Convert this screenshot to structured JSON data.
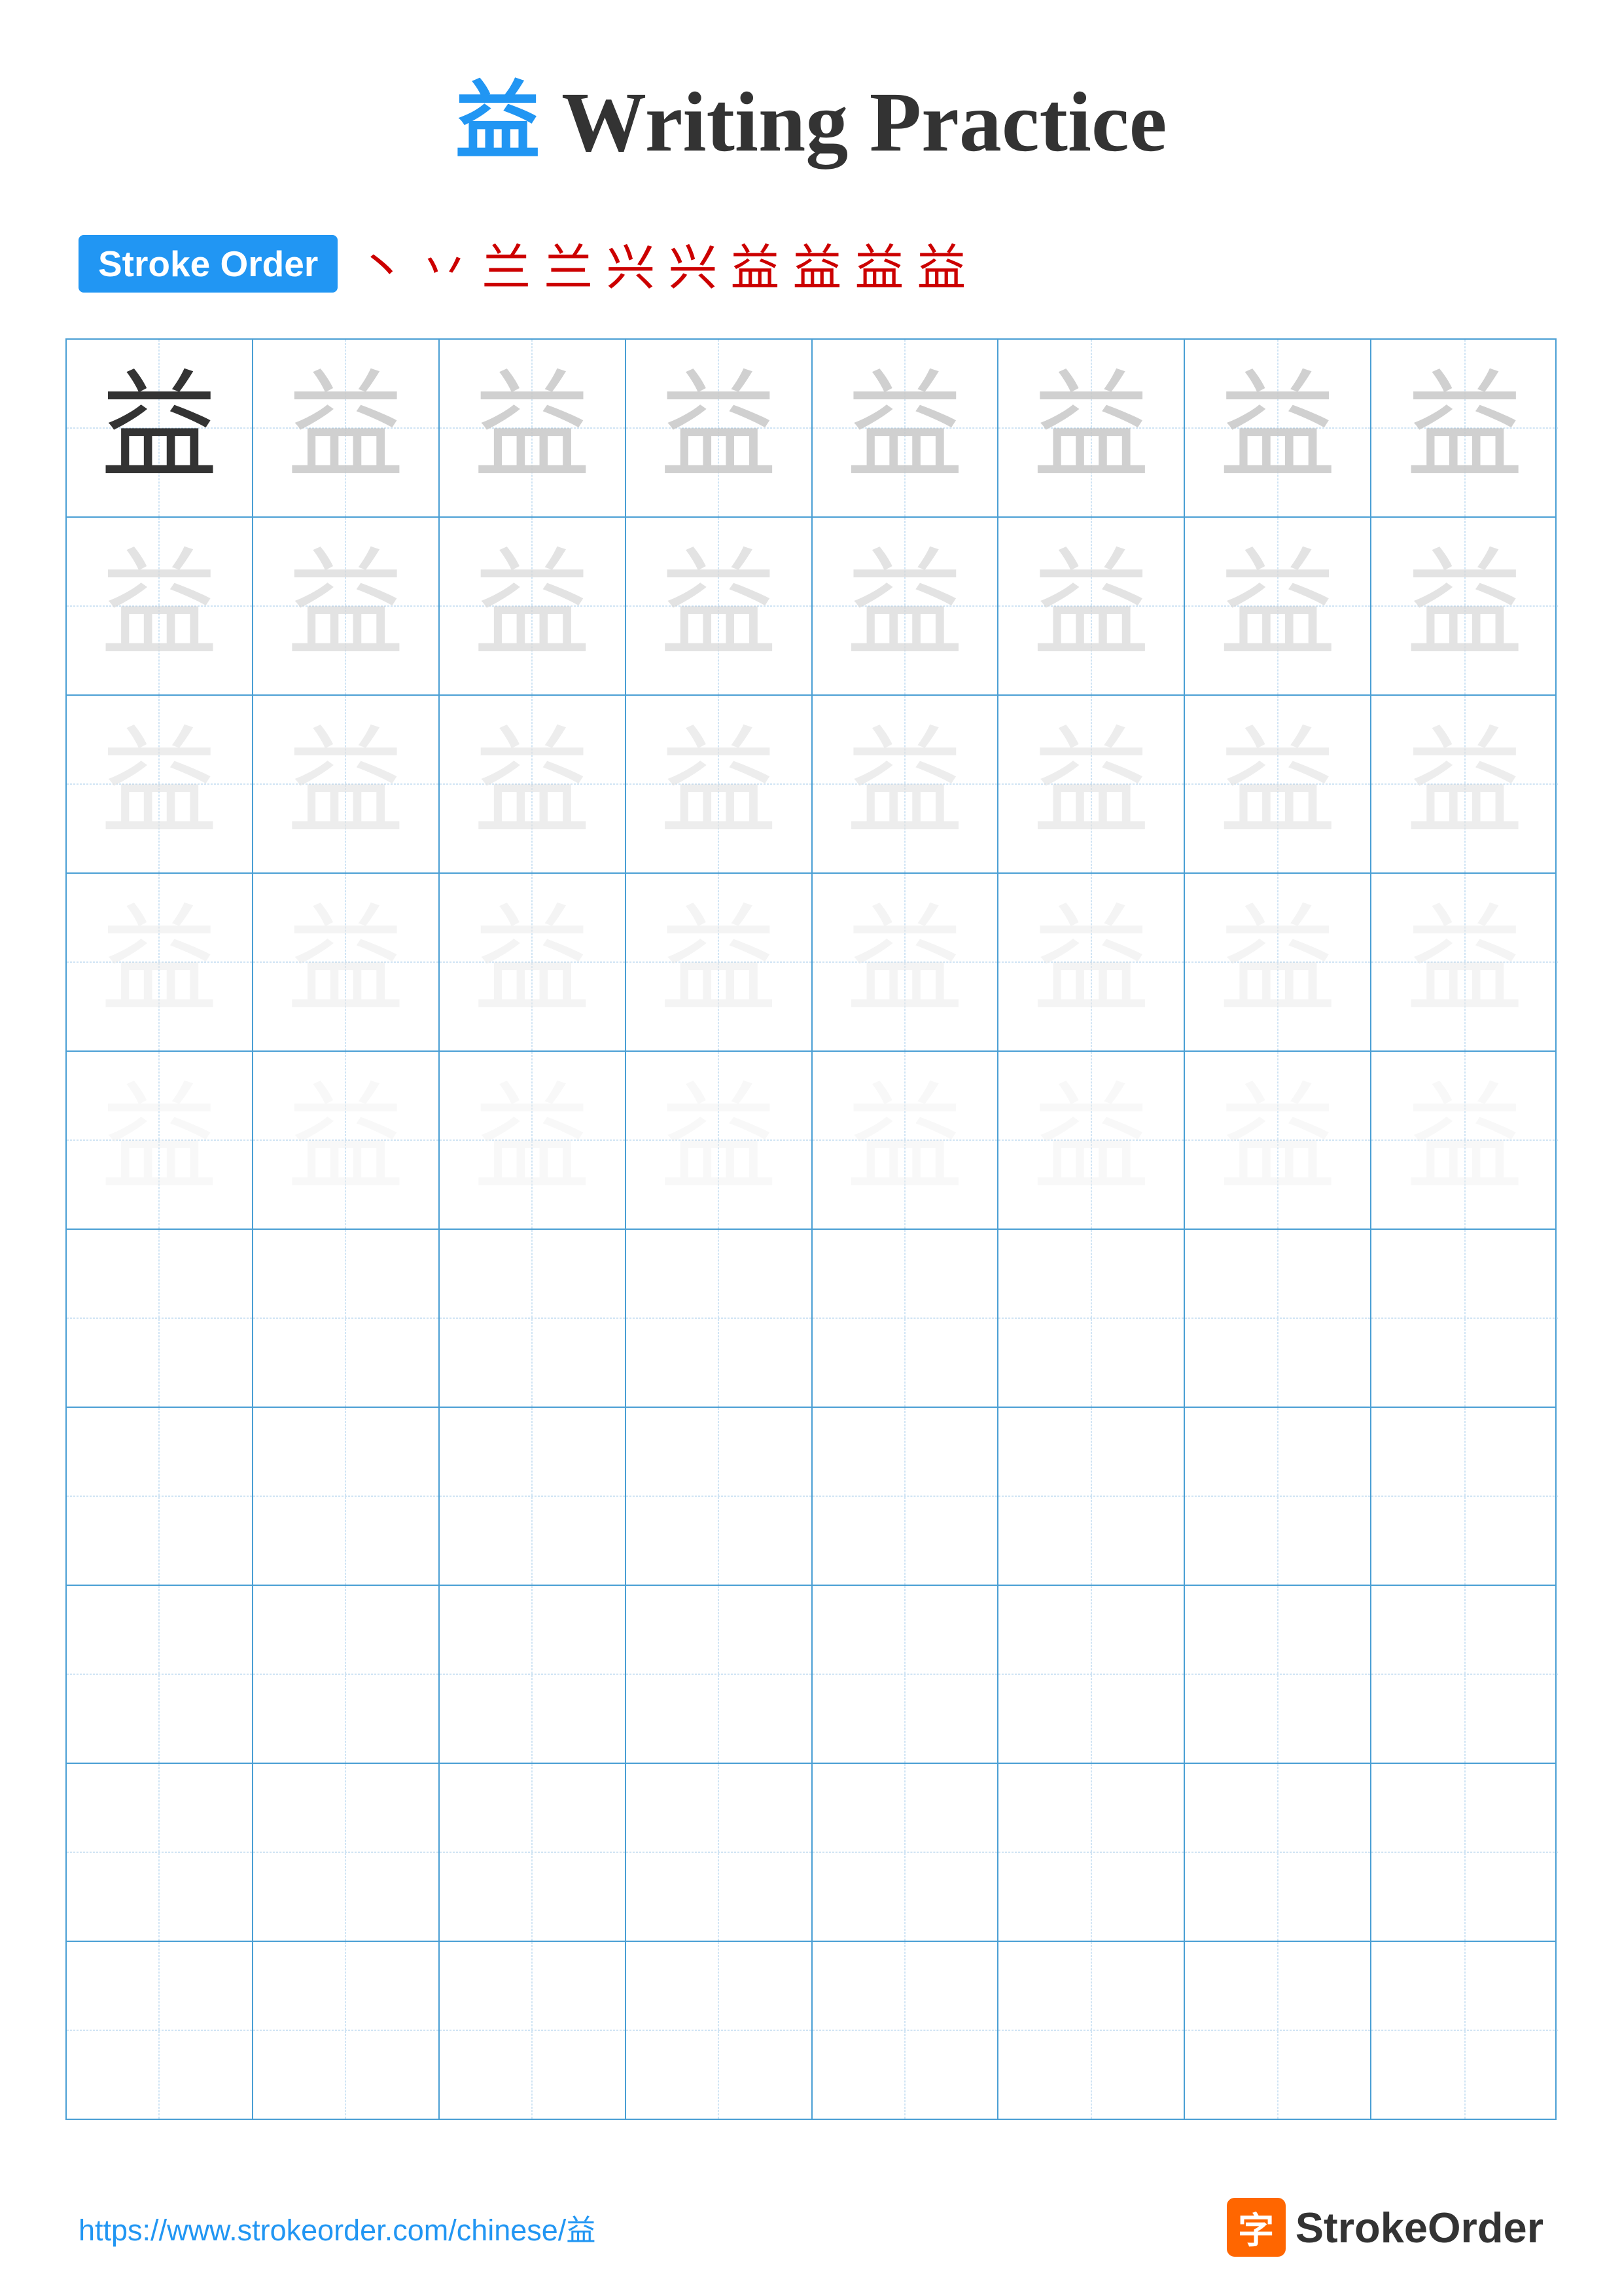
{
  "title": {
    "char": "益",
    "text": " Writing Practice"
  },
  "stroke_order": {
    "badge_label": "Stroke Order",
    "sequence": [
      "丶",
      "丷",
      "兰",
      "兰",
      "兴",
      "兴",
      "益",
      "益",
      "益",
      "益"
    ]
  },
  "grid": {
    "cols": 8,
    "practice_rows": 5,
    "empty_rows": 5,
    "char": "益"
  },
  "footer": {
    "url": "https://www.strokeorder.com/chinese/益",
    "brand_char": "字",
    "brand_name": "StrokeOrder"
  }
}
